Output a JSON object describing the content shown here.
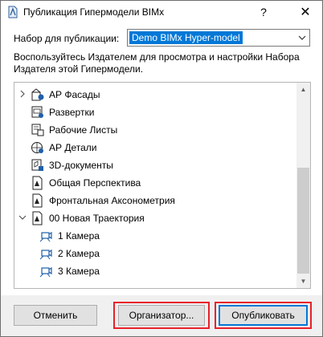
{
  "window": {
    "title": "Публикация Гипермодели BIMx",
    "help_label": "?",
    "close_label": "✕"
  },
  "publish_set": {
    "label": "Набор для публикации:",
    "selected": "Demo BIMx Hyper-model"
  },
  "description": "Воспользуйтесь Издателем для просмотра и настройки Набора Издателя этой Гипермодели.",
  "tree": {
    "items": [
      {
        "label": "АР Фасады",
        "icon": "elevation-icon",
        "expander": "collapsed"
      },
      {
        "label": "Развертки",
        "icon": "interior-elevation-icon",
        "expander": "none"
      },
      {
        "label": "Рабочие Листы",
        "icon": "worksheet-icon",
        "expander": "none"
      },
      {
        "label": "АР Детали",
        "icon": "detail-icon",
        "expander": "none"
      },
      {
        "label": "3D-документы",
        "icon": "3d-document-icon",
        "expander": "none"
      },
      {
        "label": "Общая Перспектива",
        "icon": "perspective-icon",
        "expander": "none"
      },
      {
        "label": "Фронтальная Аксонометрия",
        "icon": "axonometry-icon",
        "expander": "none"
      },
      {
        "label": "00 Новая Траектория",
        "icon": "path-icon",
        "expander": "expanded"
      },
      {
        "label": "1 Камера",
        "icon": "camera-icon",
        "expander": "none"
      },
      {
        "label": "2 Камера",
        "icon": "camera-icon",
        "expander": "none"
      },
      {
        "label": "3 Камера",
        "icon": "camera-icon",
        "expander": "none"
      }
    ]
  },
  "buttons": {
    "cancel": "Отменить",
    "organizer": "Организатор...",
    "publish": "Опубликовать"
  },
  "colors": {
    "accent": "#0078d7",
    "highlight_frame": "#e8202a",
    "icon_blue": "#1f5fa8"
  }
}
